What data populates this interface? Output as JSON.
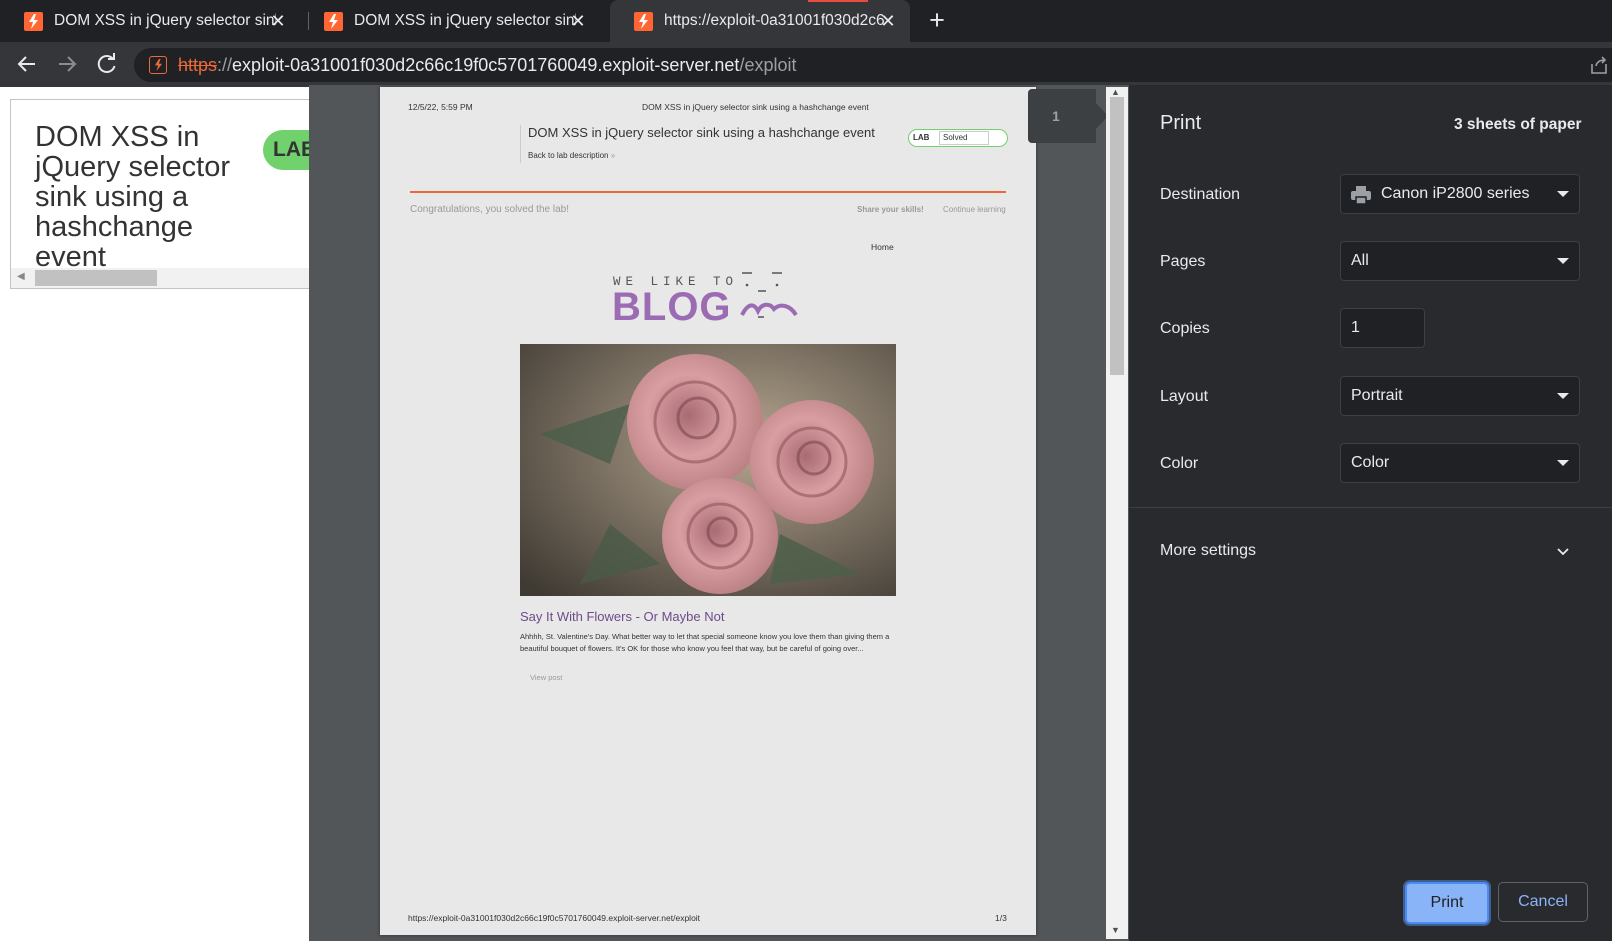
{
  "browser": {
    "tabs": [
      {
        "title": "DOM XSS in jQuery selector sink"
      },
      {
        "title": "DOM XSS in jQuery selector sink"
      },
      {
        "title": "https://exploit-0a31001f030d2c6"
      }
    ],
    "new_tab_label": "+",
    "address": {
      "scheme": "https",
      "separator": "://",
      "host": "exploit-0a31001f030d2c66c19f0c5701760049.exploit-server.net",
      "path": "/exploit"
    }
  },
  "underlying_page": {
    "title": "DOM XSS in jQuery selector sink using a hashchange event",
    "badge": "LAB"
  },
  "preview": {
    "page_indicator": "1",
    "header_date": "12/5/22, 5:59 PM",
    "header_title": "DOM XSS in jQuery selector sink using a hashchange event",
    "lab_title": "DOM XSS in jQuery selector sink using a hashchange event",
    "back_link": "Back to lab description",
    "badge_lab": "LAB",
    "badge_status": "Solved",
    "congrats": "Congratulations, you solved the lab!",
    "share": "Share your skills!",
    "continue": "Continue learning",
    "home": "Home",
    "blog_tagline": "WE LIKE TO",
    "blog_word": "BLOG",
    "post_title": "Say It With Flowers - Or Maybe Not",
    "post_summary": "Ahhhh, St. Valentine's Day. What better way to let that special someone know you love them than giving them a beautiful bouquet of flowers. It's OK for those who know you feel that way, but be careful of going over...",
    "view_post": "View post",
    "footer_url": "https://exploit-0a31001f030d2c66c19f0c5701760049.exploit-server.net/exploit",
    "page_count": "1/3"
  },
  "print_settings": {
    "title": "Print",
    "sheets": "3 sheets of paper",
    "destination_label": "Destination",
    "destination_value": "Canon iP2800 series",
    "pages_label": "Pages",
    "pages_value": "All",
    "copies_label": "Copies",
    "copies_value": "1",
    "layout_label": "Layout",
    "layout_value": "Portrait",
    "color_label": "Color",
    "color_value": "Color",
    "more_settings": "More settings",
    "print_button": "Print",
    "cancel_button": "Cancel"
  },
  "colors": {
    "chrome_dark": "#202124",
    "chrome_toolbar": "#35363a",
    "brand_orange": "#ff6633",
    "lab_green": "#70d16d",
    "blog_purple": "#9b6bb3",
    "print_blue": "#8ab4f8"
  }
}
